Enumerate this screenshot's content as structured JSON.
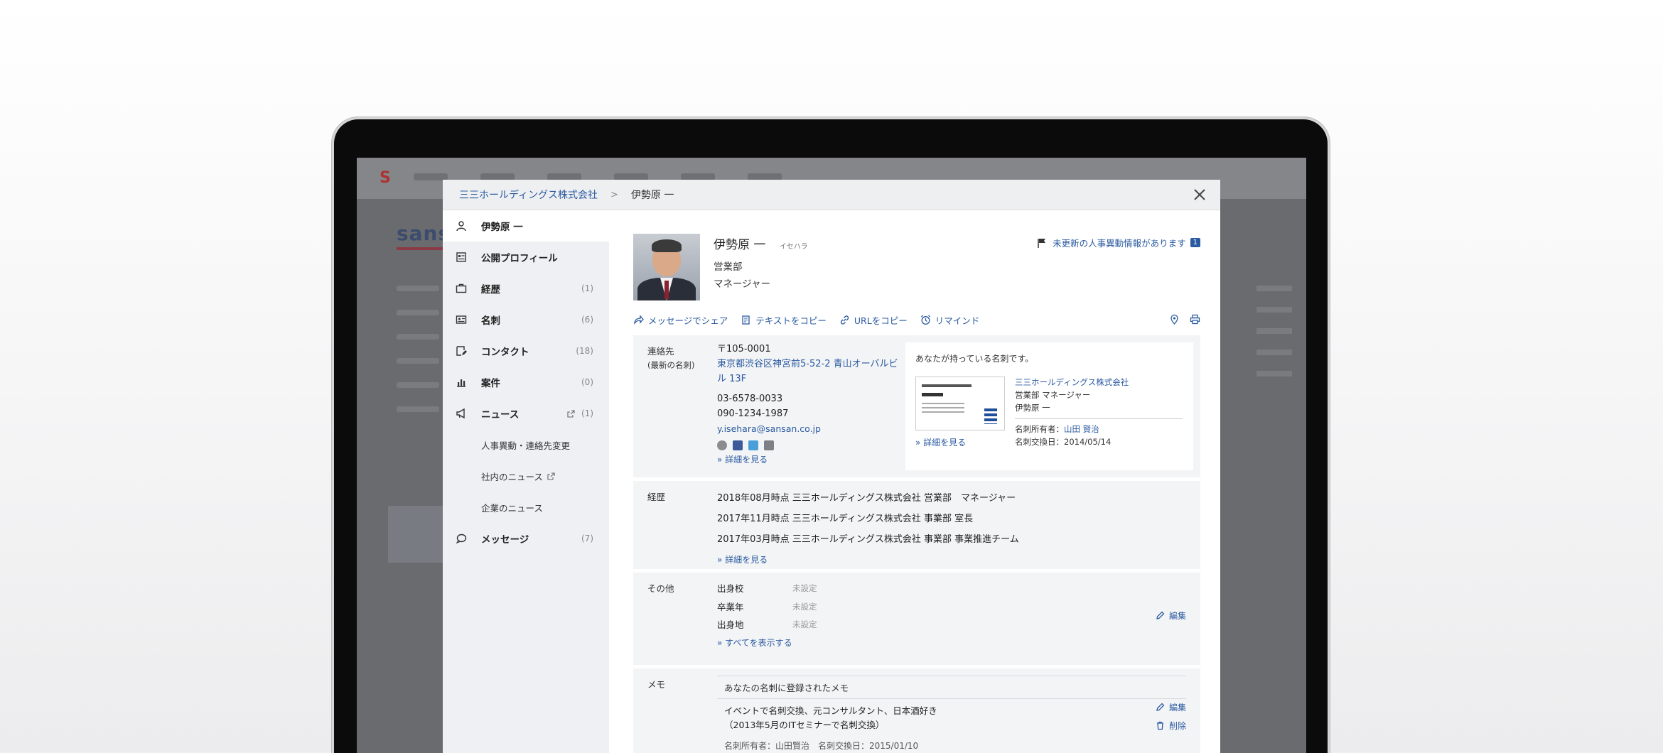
{
  "breadcrumb": {
    "company": "三三ホールディングス株式会社",
    "separator": ">",
    "current": "伊勢原 一"
  },
  "sidebar": {
    "items": [
      {
        "label": "伊勢原 一",
        "count": ""
      },
      {
        "label": "公開プロフィール",
        "count": ""
      },
      {
        "label": "経歴",
        "count": "(1)"
      },
      {
        "label": "名刺",
        "count": "(6)"
      },
      {
        "label": "コンタクト",
        "count": "(18)"
      },
      {
        "label": "案件",
        "count": "(0)"
      },
      {
        "label": "ニュース",
        "count": "(1)"
      }
    ],
    "news_sub": [
      "人事異動・連絡先変更",
      "社内のニュース",
      "企業のニュース"
    ],
    "message": {
      "label": "メッセージ",
      "count": "(7)"
    }
  },
  "profile": {
    "name": "伊勢原 一",
    "kana": "イセハラ",
    "department": "営業部",
    "title": "マネージャー",
    "notice": "未更新の人事異動情報があります",
    "notice_count": "1"
  },
  "actions": {
    "share": "メッセージでシェア",
    "copy_text": "テキストをコピー",
    "copy_url": "URLをコピー",
    "remind": "リマインド"
  },
  "contact": {
    "label": "連絡先",
    "label_sub": "(最新の名刺)",
    "zip": "〒105-0001",
    "address": "東京都渋谷区神宮前5-52-2 青山オーバルビル 13F",
    "phone1": "03-6578-0033",
    "phone2": "090-1234-1987",
    "email": "y.isehara@sansan.co.jp",
    "more": "» 詳細を見る"
  },
  "card": {
    "heading": "あなたが持っている名刺です。",
    "company": "三三ホールディングス株式会社",
    "dept_title": "営業部 マネージャー",
    "name": "伊勢原 一",
    "owner_label": "名刺所有者：",
    "owner": "山田 賢治",
    "exchange": "名刺交換日：2014/05/14",
    "more": "» 詳細を見る"
  },
  "career": {
    "label": "経歴",
    "rows": [
      "2018年08月時点 三三ホールディングス株式会社 営業部　マネージャー",
      "2017年11月時点 三三ホールディングス株式会社 事業部 室長",
      "2017年03月時点 三三ホールディングス株式会社 事業部 事業推進チーム"
    ],
    "more": "» 詳細を見る"
  },
  "other": {
    "label": "その他",
    "rows": [
      {
        "k": "出身校",
        "v": "未設定"
      },
      {
        "k": "卒業年",
        "v": "未設定"
      },
      {
        "k": "出身地",
        "v": "未設定"
      }
    ],
    "more": "» すべてを表示する",
    "edit": "編集"
  },
  "memo": {
    "label": "メモ",
    "head": "あなたの名刺に登録されたメモ",
    "line1": "イベントで名刺交換、元コンサルタント、日本酒好き",
    "line2": "（2013年5月のITセミナーで名刺交換）",
    "meta": "名刺所有者：山田賢治　名刺交換日：2015/01/10",
    "edit": "編集",
    "delete": "削除"
  },
  "background": {
    "brand": "sansan"
  },
  "colors": {
    "link": "#2a5aa0",
    "sidebar_bg": "#eef0f3",
    "section_bg": "#f3f4f6"
  }
}
